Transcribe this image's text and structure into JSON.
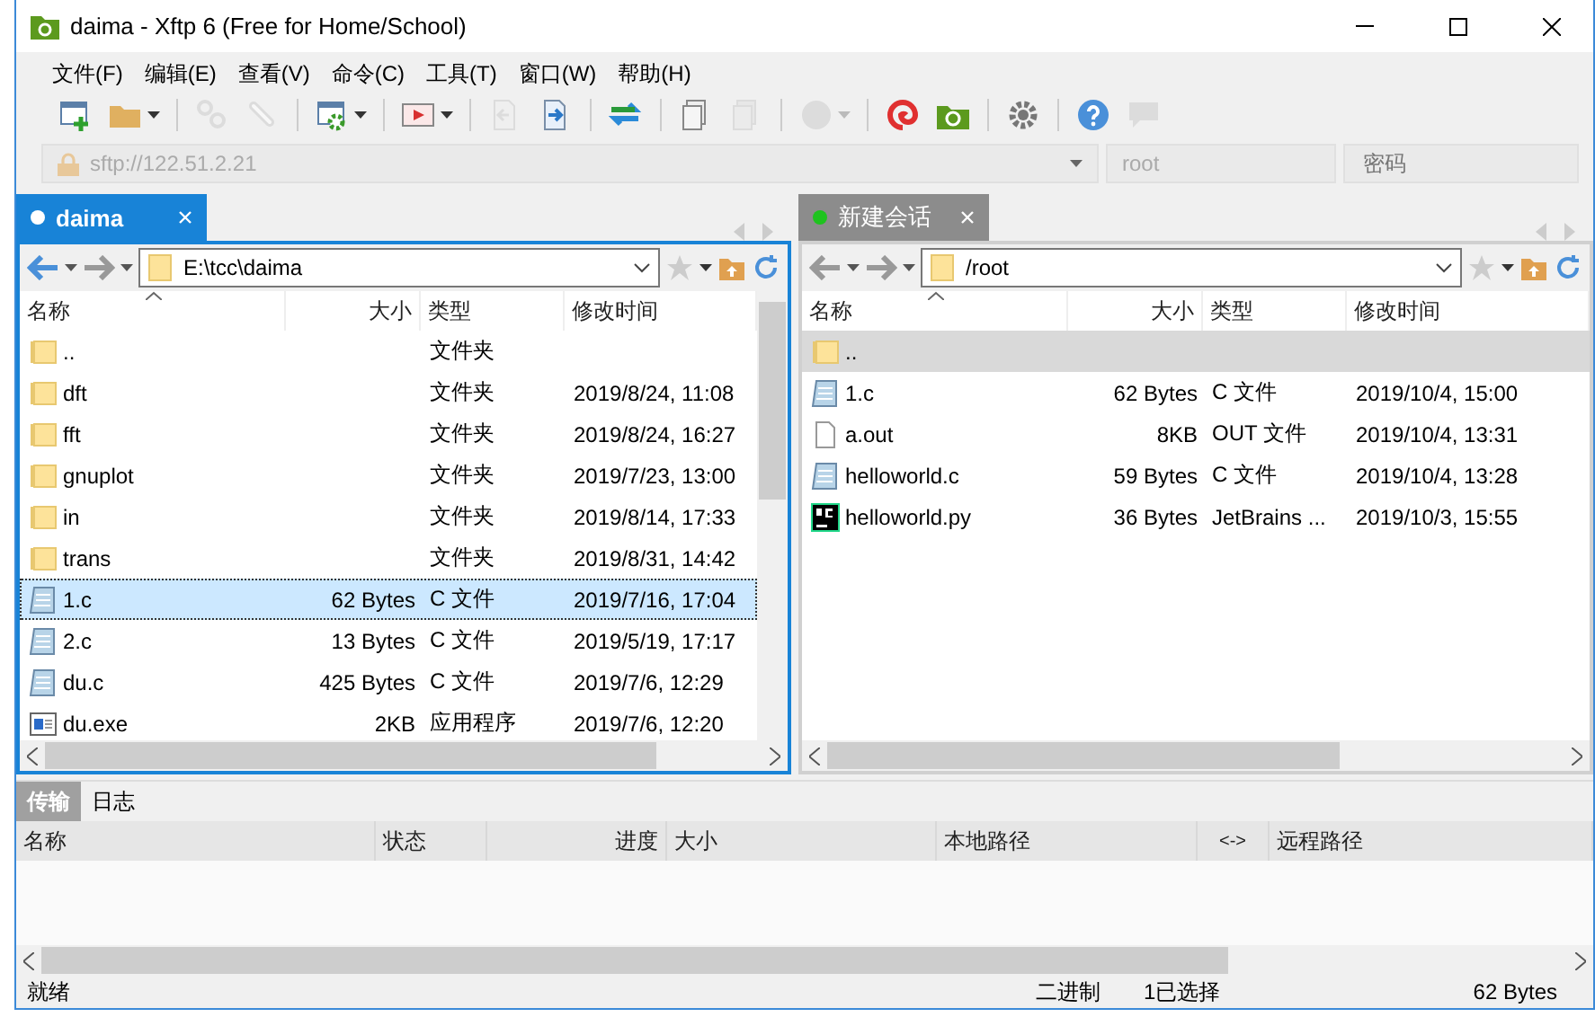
{
  "window": {
    "title": "daima - Xftp 6 (Free for Home/School)"
  },
  "menu": [
    "文件(F)",
    "编辑(E)",
    "查看(V)",
    "命令(C)",
    "工具(T)",
    "窗口(W)",
    "帮助(H)"
  ],
  "toolbar": [
    {
      "kind": "window-plus",
      "disabled": false,
      "dropdown": false
    },
    {
      "kind": "folder",
      "disabled": false,
      "dropdown": true
    },
    {
      "kind": "separator"
    },
    {
      "kind": "broken-link",
      "disabled": true,
      "dropdown": false
    },
    {
      "kind": "link",
      "disabled": true,
      "dropdown": false
    },
    {
      "kind": "separator"
    },
    {
      "kind": "window-gear",
      "disabled": false,
      "dropdown": true
    },
    {
      "kind": "separator"
    },
    {
      "kind": "play",
      "disabled": false,
      "dropdown": true
    },
    {
      "kind": "separator"
    },
    {
      "kind": "doc-left",
      "disabled": true,
      "dropdown": false
    },
    {
      "kind": "doc-right",
      "disabled": false,
      "dropdown": false
    },
    {
      "kind": "separator"
    },
    {
      "kind": "swap",
      "disabled": false,
      "dropdown": false
    },
    {
      "kind": "separator"
    },
    {
      "kind": "document",
      "disabled": false,
      "dropdown": false
    },
    {
      "kind": "documents",
      "disabled": true,
      "dropdown": false
    },
    {
      "kind": "separator"
    },
    {
      "kind": "circle",
      "disabled": true,
      "dropdown": true
    },
    {
      "kind": "separator"
    },
    {
      "kind": "swirl",
      "disabled": false,
      "dropdown": false
    },
    {
      "kind": "app",
      "disabled": false,
      "dropdown": false
    },
    {
      "kind": "separator"
    },
    {
      "kind": "gear",
      "disabled": false,
      "dropdown": false
    },
    {
      "kind": "separator"
    },
    {
      "kind": "help",
      "disabled": false,
      "dropdown": false
    },
    {
      "kind": "speech",
      "disabled": true,
      "dropdown": false
    }
  ],
  "address": {
    "host": "sftp://122.51.2.21",
    "user": "root",
    "password_placeholder": "密码"
  },
  "panes": [
    {
      "tab": {
        "label": "daima",
        "selected": true,
        "color": "#ffffff"
      },
      "path": "E:\\tcc\\daima",
      "columns": [
        "名称",
        "大小",
        "类型",
        "修改时间"
      ],
      "rows": [
        {
          "kind": "folder",
          "name": "..",
          "size": "",
          "type": "文件夹",
          "modified": "",
          "selected": false
        },
        {
          "kind": "folder",
          "name": "dft",
          "size": "",
          "type": "文件夹",
          "modified": "2019/8/24, 11:08",
          "selected": false
        },
        {
          "kind": "folder",
          "name": "fft",
          "size": "",
          "type": "文件夹",
          "modified": "2019/8/24, 16:27",
          "selected": false
        },
        {
          "kind": "folder",
          "name": "gnuplot",
          "size": "",
          "type": "文件夹",
          "modified": "2019/7/23, 13:00",
          "selected": false
        },
        {
          "kind": "folder",
          "name": "in",
          "size": "",
          "type": "文件夹",
          "modified": "2019/8/14, 17:33",
          "selected": false
        },
        {
          "kind": "folder",
          "name": "trans",
          "size": "",
          "type": "文件夹",
          "modified": "2019/8/31, 14:42",
          "selected": false
        },
        {
          "kind": "text",
          "name": "1.c",
          "size": "62 Bytes",
          "type": "C 文件",
          "modified": "2019/7/16, 17:04",
          "selected": true
        },
        {
          "kind": "text",
          "name": "2.c",
          "size": "13 Bytes",
          "type": "C 文件",
          "modified": "2019/5/19, 17:17",
          "selected": false
        },
        {
          "kind": "text",
          "name": "du.c",
          "size": "425 Bytes",
          "type": "C 文件",
          "modified": "2019/7/6, 12:29",
          "selected": false
        },
        {
          "kind": "program",
          "name": "du.exe",
          "size": "2KB",
          "type": "应用程序",
          "modified": "2019/7/6, 12:20",
          "selected": false
        }
      ]
    },
    {
      "tab": {
        "label": "新建会话",
        "selected": false,
        "color": "#1ec31e"
      },
      "path": "/root",
      "columns": [
        "名称",
        "大小",
        "类型",
        "修改时间"
      ],
      "rows": [
        {
          "kind": "folder",
          "name": "..",
          "size": "",
          "type": "",
          "modified": "",
          "selected": true
        },
        {
          "kind": "text",
          "name": "1.c",
          "size": "62 Bytes",
          "type": "C 文件",
          "modified": "2019/10/4, 15:00",
          "selected": false
        },
        {
          "kind": "file",
          "name": "a.out",
          "size": "8KB",
          "type": "OUT 文件",
          "modified": "2019/10/4, 13:31",
          "selected": false
        },
        {
          "kind": "text",
          "name": "helloworld.c",
          "size": "59 Bytes",
          "type": "C 文件",
          "modified": "2019/10/4, 13:28",
          "selected": false
        },
        {
          "kind": "pycharm",
          "name": "helloworld.py",
          "size": "36 Bytes",
          "type": "JetBrains ...",
          "modified": "2019/10/3, 15:55",
          "selected": false
        }
      ]
    }
  ],
  "transfer": {
    "tabs": [
      {
        "label": "传输",
        "selected": true
      },
      {
        "label": "日志",
        "selected": false
      }
    ],
    "columns": [
      "名称",
      "状态",
      "进度",
      "大小",
      "本地路径",
      "<->",
      "远程路径"
    ]
  },
  "status_bar": {
    "state": "就绪",
    "mode": "二进制",
    "selection": "1已选择",
    "size": "62 Bytes"
  }
}
